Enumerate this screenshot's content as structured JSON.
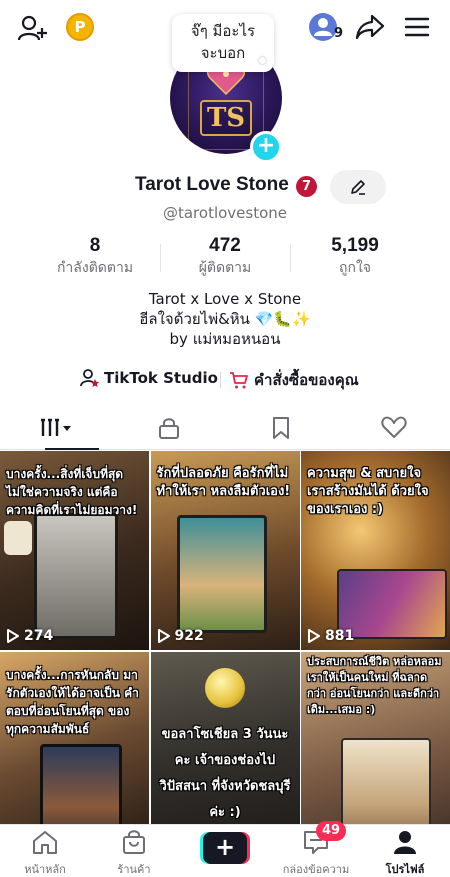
{
  "topbar": {
    "add_friend_icon": "add-user-icon",
    "coin_letter": "P",
    "bubble_line1": "จ๊ๆ มีอะไร",
    "bubble_line2": "จะบอก",
    "friends_count": "9",
    "share_icon": "share-icon",
    "menu_icon": "hamburger-menu-icon"
  },
  "profile": {
    "avatar_text": "TS",
    "name": "Tarot Love Stone",
    "badge": "7",
    "handle": "@tarotlovestone"
  },
  "stats": [
    {
      "value": "8",
      "label": "กำลังติดตาม"
    },
    {
      "value": "472",
      "label": "ผู้ติดตาม"
    },
    {
      "value": "5,199",
      "label": "ถูกใจ"
    }
  ],
  "bio": {
    "line1": "Tarot x Love x Stone",
    "line2": "ฮีลใจด้วยไพ่&หิน 💎🐛✨",
    "line3": "by แม่หมอหนอน"
  },
  "links": {
    "studio": "TikTok Studio",
    "orders": "คำสั่งซื้อของคุณ"
  },
  "tabs": [
    "videos",
    "private",
    "saved",
    "liked"
  ],
  "videos": [
    {
      "caption": "บางครั้ง...สิ่งที่เจ็บที่สุด ไม่ใช่ความจริง แต่คือ ความคิดที่เราไม่ยอมวาง!",
      "views": "274"
    },
    {
      "caption": "รักที่ปลอดภัย คือรักที่ไม่ทำให้เรา หลงลืมตัวเอง!",
      "views": "922"
    },
    {
      "caption": "ความสุข & สบายใจ เราสร้างมันได้ ด้วยใจของเราเอง :)",
      "views": "881"
    },
    {
      "caption": "บางครั้ง...การหันกลับ มารักตัวเองให้ได้อาจเป็น คำตอบที่อ่อนโยนที่สุด ของทุกความสัมพันธ์",
      "views": ""
    },
    {
      "caption": "ขอลาโซเชียล 3 วันนะคะ เจ้าของช่องไปวิปัสสนา ที่จังหวัดชลบุรีค่ะ :)",
      "views": ""
    },
    {
      "caption": "ประสบการณ์ชีวิต หล่อหลอมเราให้เป็นคนใหม่ ที่ฉลาดกว่า อ่อนโยนกว่า และดีกว่าเดิม...เสมอ :)",
      "views": ""
    }
  ],
  "bottomnav": {
    "home": "หน้าหลัก",
    "shop": "ร้านค้า",
    "inbox": "กล่องข้อความ",
    "inbox_badge": "49",
    "profile": "โปรไฟล์"
  },
  "colors": {
    "accent_cyan": "#20d5ec",
    "badge_red": "#c0163a",
    "notification_red": "#fe2c55",
    "text_primary": "#161823",
    "text_secondary": "#6e6f75"
  }
}
